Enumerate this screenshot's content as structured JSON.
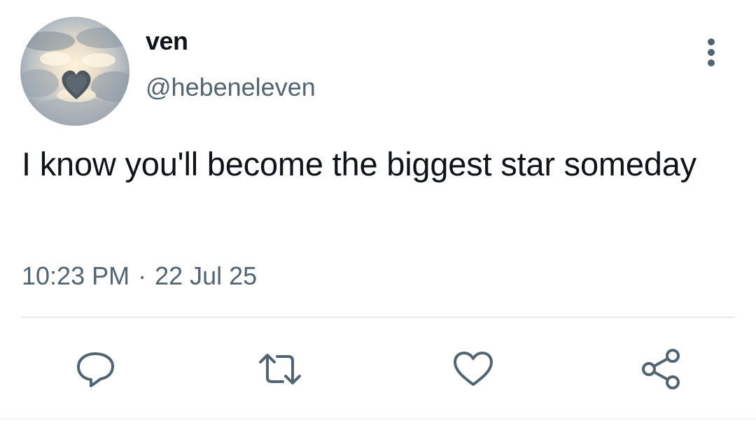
{
  "user": {
    "display_name": "ven",
    "handle": "@hebeneleven",
    "avatar_icon": "sky-heart-cloud-avatar"
  },
  "tweet": {
    "text": "I know you'll become the biggest star someday",
    "time": "10:23 PM",
    "separator": "·",
    "date": "22 Jul 25"
  },
  "actions": {
    "reply_icon": "reply-icon",
    "retweet_icon": "retweet-icon",
    "like_icon": "heart-icon",
    "share_icon": "share-icon",
    "more_icon": "more-vertical-icon"
  },
  "colors": {
    "text_primary": "#0f1419",
    "text_secondary": "#536471",
    "icon": "#536471",
    "divider": "#e6ecf0"
  }
}
